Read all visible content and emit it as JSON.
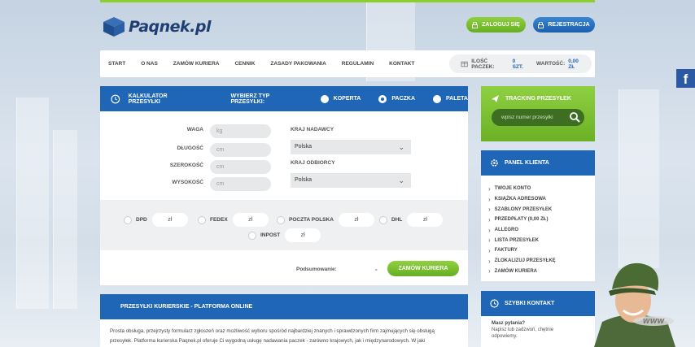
{
  "header": {
    "logo_text": "Paqnek.pl",
    "login_label": "ZALOGUJ SIĘ",
    "register_label": "REJESTRACJA"
  },
  "nav": {
    "items": [
      "START",
      "O NAS",
      "ZAMÓW KURIERA",
      "CENNIK",
      "ZASADY PAKOWANIA",
      "REGULAMIN",
      "KONTAKT"
    ]
  },
  "cart": {
    "count_label": "ILOŚĆ PACZEK:",
    "count_value": "0 SZT.",
    "value_label": "WARTOŚĆ:",
    "value_value": "0,00 ZŁ"
  },
  "social": {
    "facebook": "f"
  },
  "calculator": {
    "title": "KALKULATOR PRZESYŁKI",
    "type_label": "WYBIERZ TYP PRZESYŁKI:",
    "types": [
      {
        "label": "KOPERTA",
        "selected": false
      },
      {
        "label": "PACZKA",
        "selected": true
      },
      {
        "label": "PALETA",
        "selected": false
      }
    ],
    "fields": [
      {
        "label": "WAGA",
        "placeholder": "kg"
      },
      {
        "label": "DŁUGOŚĆ",
        "placeholder": "cm"
      },
      {
        "label": "SZEROKOŚĆ",
        "placeholder": "cm"
      },
      {
        "label": "WYSOKOŚĆ",
        "placeholder": "cm"
      }
    ],
    "sender_label": "KRAJ NADAWCY",
    "sender_value": "Polska",
    "receiver_label": "KRAJ ODBIORCY",
    "receiver_value": "Polska",
    "carriers": [
      {
        "name": "DPD",
        "price": "zł"
      },
      {
        "name": "FEDEX",
        "price": "zł"
      },
      {
        "name": "POCZTA POLSKA",
        "price": "zł"
      },
      {
        "name": "DHL",
        "price": "zł"
      },
      {
        "name": "INPOST",
        "price": "zł"
      }
    ],
    "summary_label": "Podsumowanie:",
    "summary_value": "-",
    "order_button": "ZAMÓW KURIERA"
  },
  "tracking": {
    "title": "TRACKING PRZESYŁEK",
    "placeholder": "wpisz numer przesyłki"
  },
  "panel": {
    "title": "PANEL KLIENTA",
    "items": [
      "TWOJE KONTO",
      "KSIĄŻKA ADRESOWA",
      "SZABLONY PRZESYŁEK",
      "PRZEDPŁATY (0,00 ZŁ)",
      "ALLEGRO",
      "LISTA PRZESYŁEK",
      "FAKTURY",
      "ZLOKALIZUJ PRZESYŁKĘ",
      "ZAMÓW KURIERA"
    ]
  },
  "contact": {
    "title": "SZYBKI KONTAKT",
    "line1": "Masz pytania?",
    "line2": "Napisz lub zadzwoń, chętnie",
    "line3": "odpowiemy."
  },
  "banner": {
    "title": "PRZESYŁKI KURIERSKIE - PLATFORMA ONLINE",
    "text": "Prosta obsługa, przejrzysty formularz zgłoszeń oraz możliwość wyboru spośród najbardziej znanych i sprawdzonych firm zajmujących się obsługą przesyłek. Platforma kurierska Paqnek.pl oferuje Ci wygodną usługę nadawania paczek - zarówno krajowych, jak i międzynarodowych. W jaki"
  },
  "mascot": {
    "cap_text": "WWW"
  },
  "colors": {
    "primary_blue": "#1f66b6",
    "accent_green": "#7cc236",
    "nav_bg": "#ffffff"
  }
}
